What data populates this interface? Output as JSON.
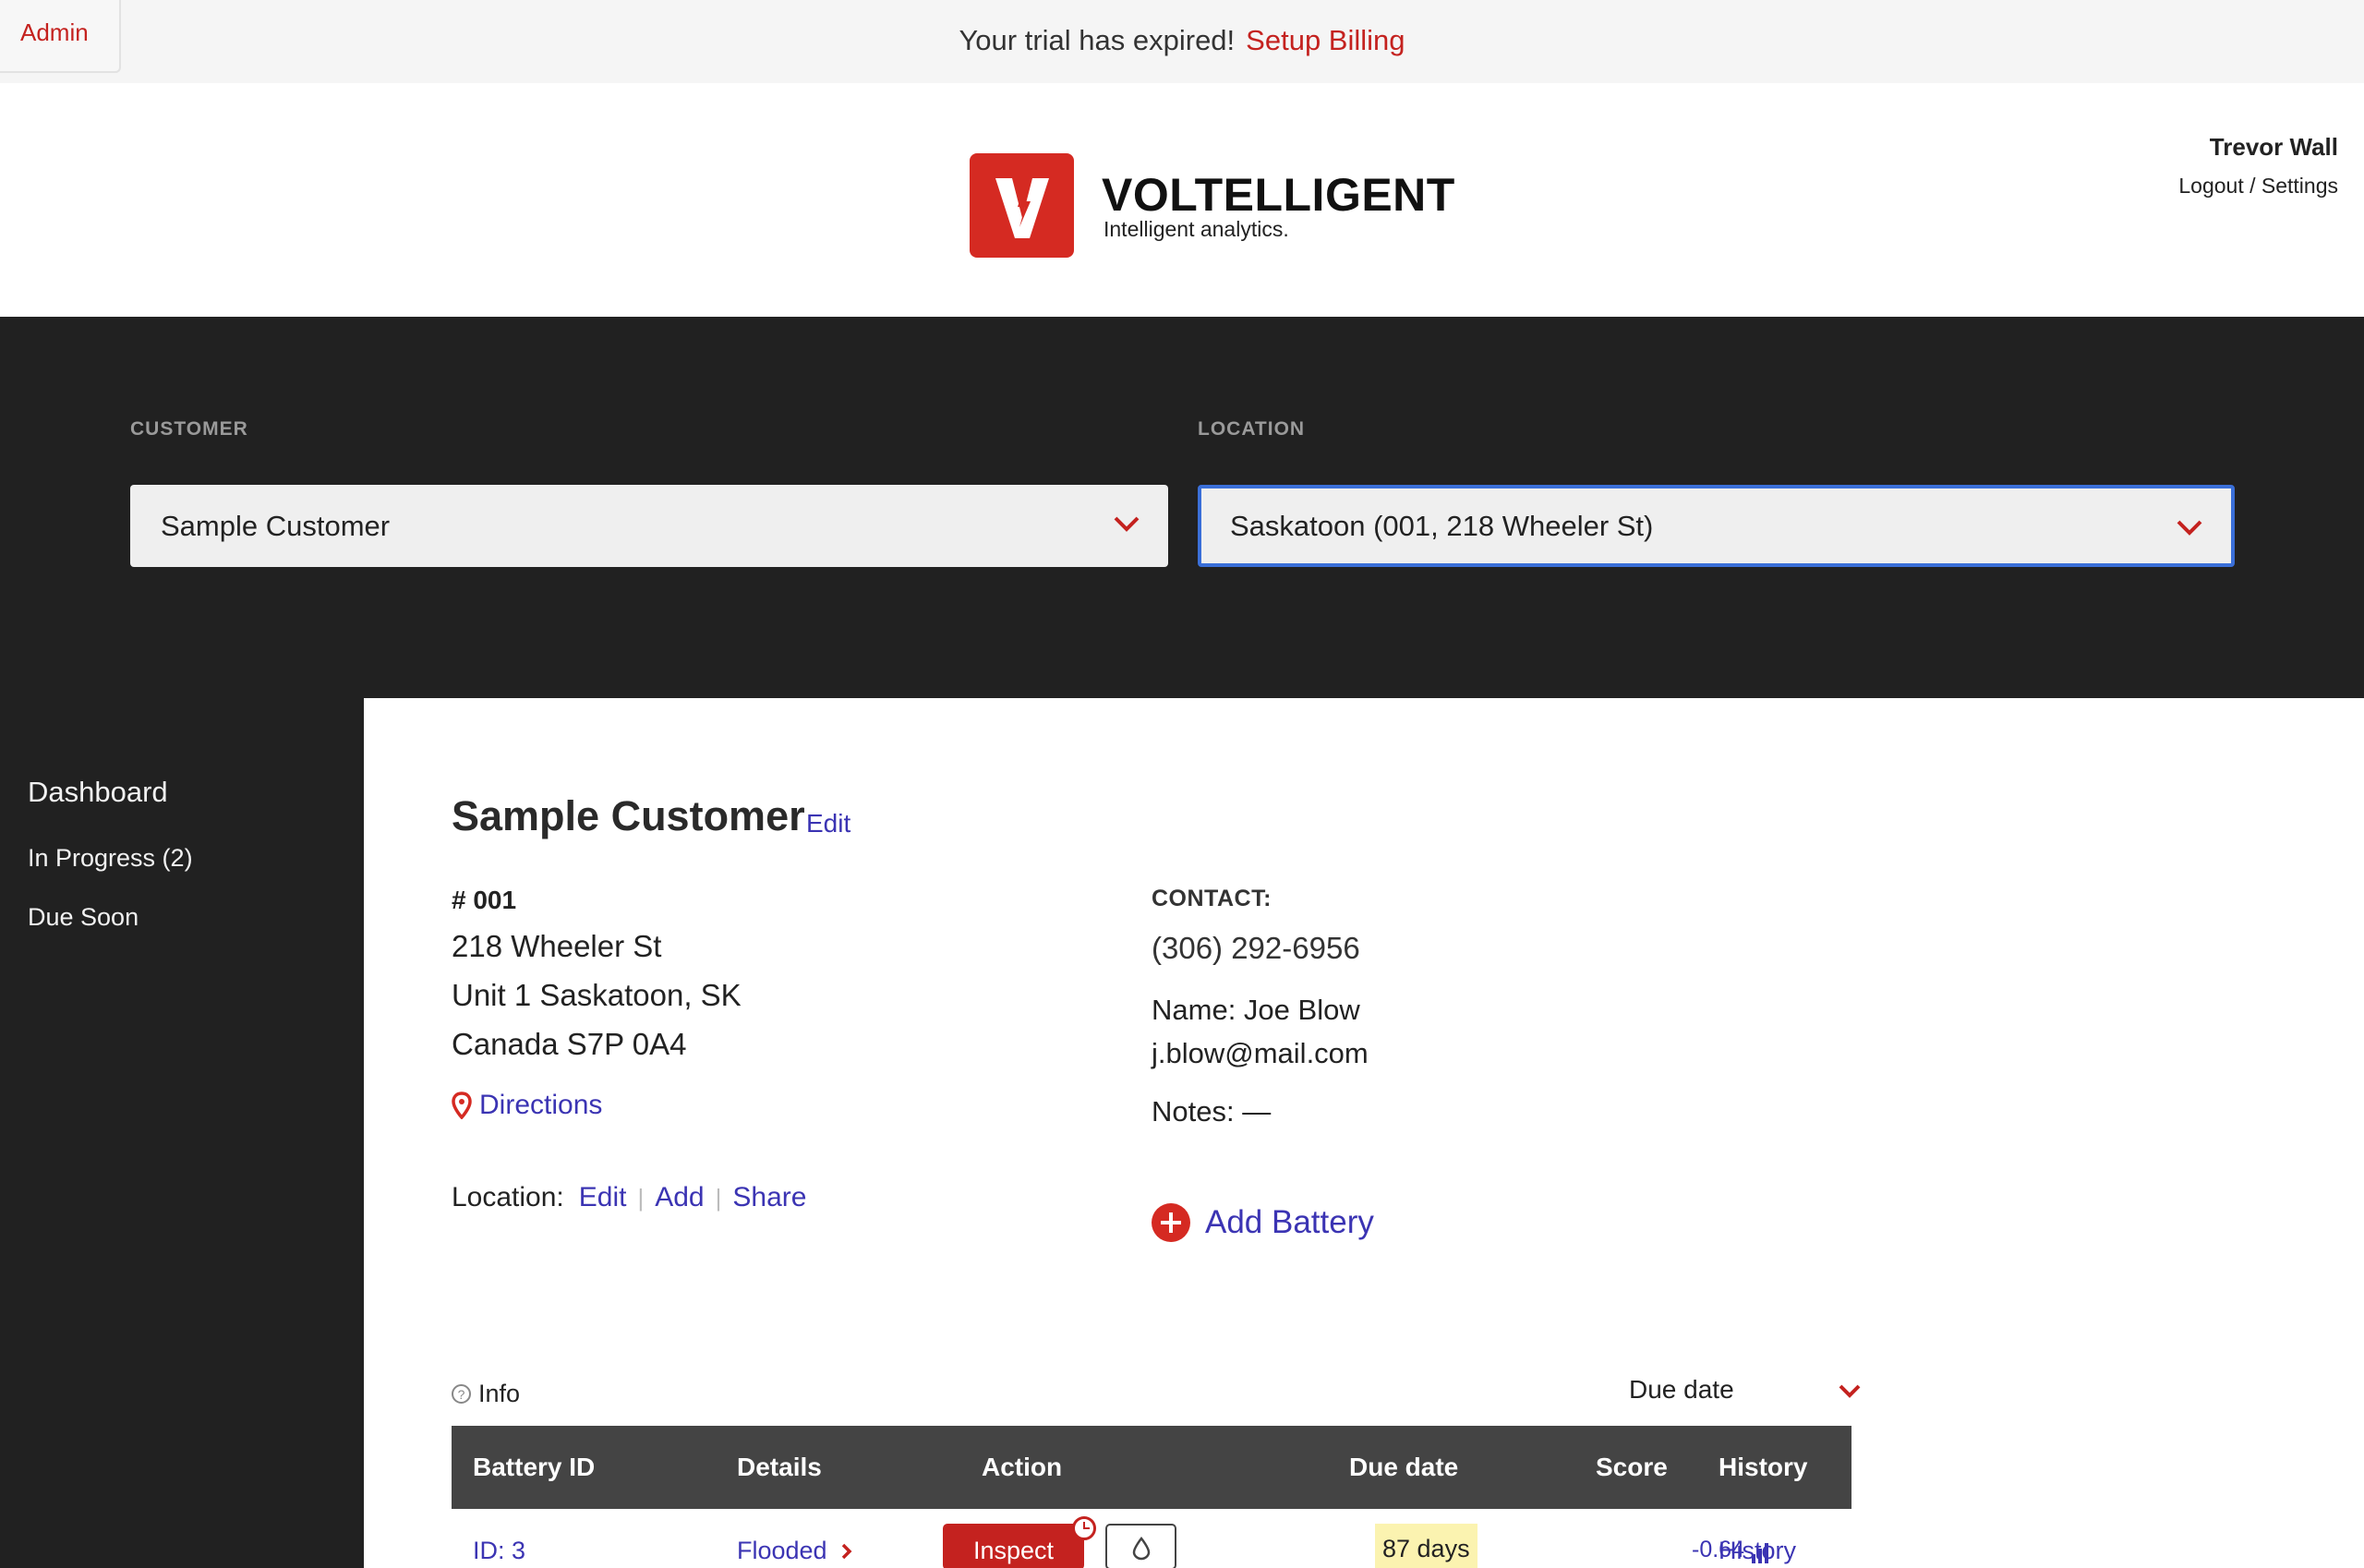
{
  "banner": {
    "admin_label": "Admin",
    "message": "Your trial has expired!",
    "billing_link": "Setup Billing"
  },
  "brand": {
    "name": "VOLTELLIGENT",
    "tagline": "Intelligent analytics.",
    "logo_letter": "V",
    "accent_color": "#d52a22"
  },
  "user": {
    "name": "Trevor Wall",
    "logout": "Logout",
    "divider": "/",
    "settings": "Settings"
  },
  "filters": {
    "customer_label": "CUSTOMER",
    "customer_value": "Sample Customer",
    "location_label": "LOCATION",
    "location_value": "Saskatoon (001, 218 Wheeler St)"
  },
  "sidebar": {
    "items": [
      {
        "label": "Dashboard"
      },
      {
        "label": "In Progress (2)"
      },
      {
        "label": "Due Soon"
      }
    ]
  },
  "location": {
    "title": "Sample Customer",
    "edit_label": "Edit",
    "number": "# 001",
    "street": "218 Wheeler St",
    "unit_city": "Unit 1 Saskatoon,  SK",
    "country_postal": "Canada  S7P 0A4",
    "directions": "Directions",
    "actions_label": "Location:",
    "action_edit": "Edit",
    "action_add": "Add",
    "action_share": "Share"
  },
  "contact": {
    "label": "CONTACT:",
    "phone": "(306) 292-6956",
    "name": "Name: Joe Blow",
    "email": "j.blow@mail.com",
    "notes": "Notes: —",
    "add_battery": "Add Battery"
  },
  "table": {
    "info_label": "Info",
    "sort_value": "Due date",
    "columns": [
      "Battery ID",
      "Details",
      "Action",
      "Due date",
      "Score",
      "History"
    ],
    "rows": [
      {
        "battery_id": "ID: 3",
        "details": "Flooded",
        "action": "Inspect",
        "due": "87 days",
        "score": "-0.64",
        "history": "History"
      }
    ]
  }
}
